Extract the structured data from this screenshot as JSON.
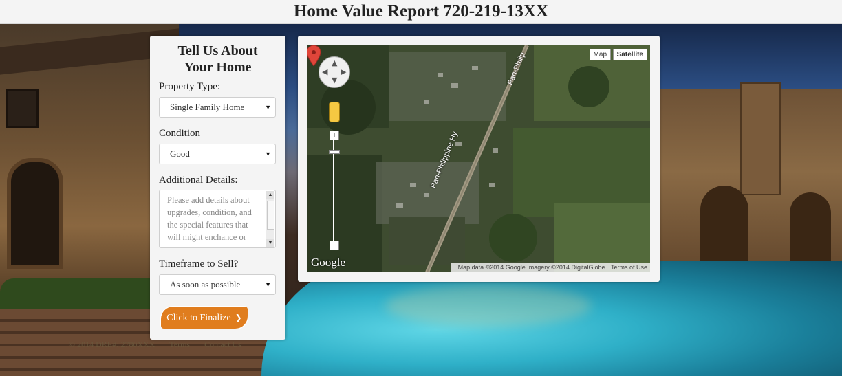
{
  "page": {
    "title": "Home Value Report 720-219-13XX"
  },
  "form": {
    "heading_line1": "Tell Us About",
    "heading_line2": "Your Home",
    "property_type": {
      "label": "Property Type:",
      "value": "Single Family Home"
    },
    "condition": {
      "label": "Condition",
      "value": "Good"
    },
    "additional_details": {
      "label": "Additional Details:",
      "placeholder": "Please add details about upgrades, condition, and the special features that will might enchance or"
    },
    "timeframe": {
      "label": "Timeframe to Sell?",
      "value": "As soon as possible"
    },
    "submit_label": "Click to Finalize",
    "submit_icon": "chevron-right-icon"
  },
  "map": {
    "type_map": "Map",
    "type_satellite": "Satellite",
    "road_label_1": "Pan-Philippine Hy",
    "road_label_2": "Pan-Philippine Hy",
    "road_label_3": "Pan-Philip",
    "zoom_in": "+",
    "zoom_out": "−",
    "logo": "Google",
    "attribution": "Map data ©2014 Google Imagery ©2014 DigitalGlobe",
    "terms": "Terms of Use",
    "marker_color": "#e0453a"
  },
  "footer": {
    "copyright": "© 2014 DRE#: 2780XXX",
    "terms": "Terms",
    "contact": "Contact Us"
  },
  "colors": {
    "accent": "#e07d1e",
    "panel": "#f4f4f4"
  }
}
